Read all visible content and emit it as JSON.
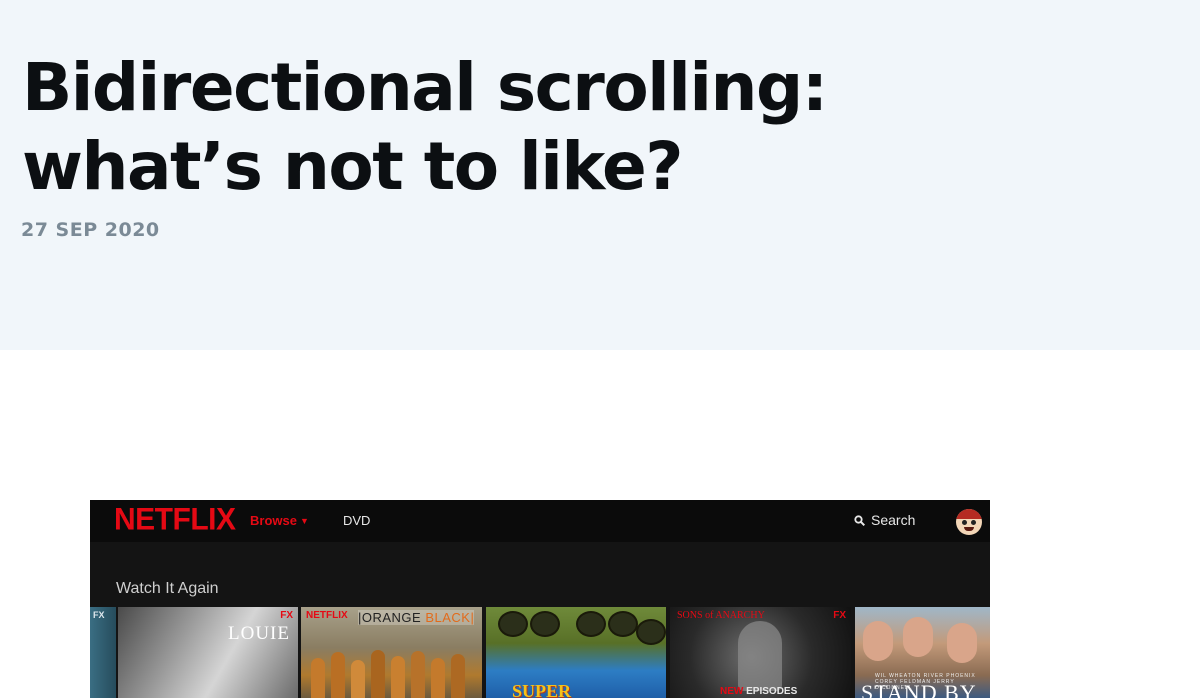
{
  "article": {
    "title": "Bidirectional scrolling: what’s not to like?",
    "date": "27 SEP 2020"
  },
  "netflix": {
    "logo": "NETFLIX",
    "nav": {
      "browse": "Browse",
      "dvd": "DVD",
      "search": "Search"
    },
    "row_title": "Watch It Again",
    "tiles": {
      "fx_left": "FX",
      "louie": "LOUIE",
      "louie_network": "FX",
      "oitnb_brand": "NETFLIX",
      "oitnb_title_a": "|ORANGE",
      "oitnb_title_b": "BLACK|",
      "troopers": "SUPER",
      "soa_title": "SONS of ANARCHY",
      "soa_network": "FX",
      "soa_new": "NEW",
      "soa_episodes": "EPISODES",
      "stand_names": "WIL WHEATON   RIVER PHOENIX   COREY FELDMAN   JERRY O'CONNELL",
      "stand_title": "STAND BY"
    },
    "colors": {
      "brand_red": "#e50914",
      "bar_bg": "#0b0b0b",
      "page_bg": "#141414"
    }
  }
}
